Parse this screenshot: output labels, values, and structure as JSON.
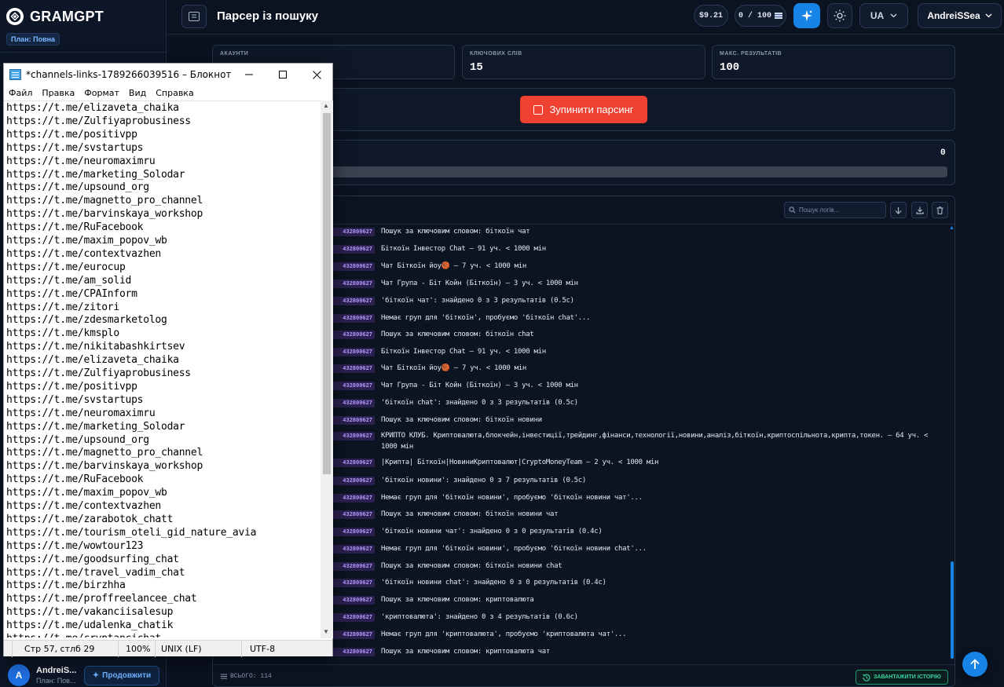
{
  "sidebar": {
    "brand": "GRAMGPT",
    "plan": "План: Повна",
    "user_initial": "A",
    "user_name": "AndreiS...",
    "user_plan": "План: Пов...",
    "upgrade_label": "Продовжити"
  },
  "header": {
    "title": "Парсер із пошуку",
    "balance": "$9.21",
    "usage": "0 / 100",
    "language": "UA",
    "username": "AndreiSSea"
  },
  "stats": [
    {
      "label": "АКАУНТИ",
      "value": ""
    },
    {
      "label": "КЛЮЧОВИХ СЛІВ",
      "value": "15"
    },
    {
      "label": "МАКС. РЕЗУЛЬТАТІВ",
      "value": "100"
    }
  ],
  "controls": {
    "stop_label": "Зупинити парсинг"
  },
  "progress": {
    "count": "0",
    "fraction": 0
  },
  "log": {
    "search_placeholder": "Пошук логів...",
    "tag": "432800627",
    "entries": [
      "Пошук за ключовим словом: біткоїн чат",
      "Біткоїн Інвестор Chat — 91 уч. < 1000 мін",
      "Чат Біткоїн йоу🏀 — 7 уч. < 1000 мін",
      "Чат Група - Біт Койн (Біткоїн) — 3 уч. < 1000 мін",
      "'біткоїн чат': знайдено 0 з 3 результатів (0.5с)",
      "Немає груп для 'біткоїн', пробуємо 'біткоїн chat'...",
      "Пошук за ключовим словом: біткоїн chat",
      "Біткоїн Інвестор Chat — 91 уч. < 1000 мін",
      "Чат Біткоїн йоу🏀 — 7 уч. < 1000 мін",
      "Чат Група - Біт Койн (Біткоїн) — 3 уч. < 1000 мін",
      "'біткоїн chat': знайдено 0 з 3 результатів (0.5с)",
      "Пошук за ключовим словом: біткоїн новини",
      "КРИПТО КЛУБ. Криптовалюта,блокчейн,інвестиції,трейдинг,фінанси,технології,новини,аналіз,біткоїн,криптоспільнота,крипта,токен. — 64 уч. < 1000 мін",
      "|Крипта| Біткоїн|НовиниКриптовалют|CryptoMoneyTeam — 2 уч. < 1000 мін",
      "'біткоїн новини': знайдено 0 з 7 результатів (0.5с)",
      "Немає груп для 'біткоїн новини', пробуємо 'біткоїн новини чат'...",
      "Пошук за ключовим словом: біткоїн новини чат",
      "'біткоїн новини чат': знайдено 0 з 0 результатів (0.4с)",
      "Немає груп для 'біткоїн новини', пробуємо 'біткоїн новини chat'...",
      "Пошук за ключовим словом: біткоїн новини chat",
      "'біткоїн новини chat': знайдено 0 з 0 результатів (0.4с)",
      "Пошук за ключовим словом: криптовалюта",
      "'криптовалюта': знайдено 0 з 4 результатів (0.6с)",
      "Немає груп для 'криптовалюта', пробуємо 'криптовалюта чат'...",
      "Пошук за ключовим словом: криптовалюта чат"
    ],
    "total_label": "ВСЬОГО: 114",
    "history_label": "ЗАВАНТАЖИТИ ІСТОРІЮ"
  },
  "notepad": {
    "title": "*channels-links-1789266039516 – Блокнот",
    "menu": [
      "Файл",
      "Правка",
      "Формат",
      "Вид",
      "Справка"
    ],
    "lines": [
      "https://t.me/elizaveta_chaika",
      "https://t.me/Zulfiyaprobusiness",
      "https://t.me/positivpp",
      "https://t.me/svstartups",
      "https://t.me/neuromaximru",
      "https://t.me/marketing_Solodar",
      "https://t.me/upsound_org",
      "https://t.me/magnetto_pro_channel",
      "https://t.me/barvinskaya_workshop",
      "https://t.me/RuFacebook",
      "https://t.me/maxim_popov_wb",
      "https://t.me/contextvazhen",
      "https://t.me/eurocup",
      "https://t.me/am_solid",
      "https://t.me/CPAInform",
      "https://t.me/zitori",
      "https://t.me/zdesmarketolog",
      "https://t.me/kmsplo",
      "https://t.me/nikitabashkirtsev",
      "https://t.me/elizaveta_chaika",
      "https://t.me/Zulfiyaprobusiness",
      "https://t.me/positivpp",
      "https://t.me/svstartups",
      "https://t.me/neuromaximru",
      "https://t.me/marketing_Solodar",
      "https://t.me/upsound_org",
      "https://t.me/magnetto_pro_channel",
      "https://t.me/barvinskaya_workshop",
      "https://t.me/RuFacebook",
      "https://t.me/maxim_popov_wb",
      "https://t.me/contextvazhen",
      "https://t.me/zarabotok_chatt",
      "https://t.me/tourism_oteli_gid_nature_avia",
      "https://t.me/wowtour123",
      "https://t.me/goodsurfing_chat",
      "https://t.me/travel_vadim_chat",
      "https://t.me/birzhha",
      "https://t.me/proffreelancee_chat",
      "https://t.me/vakanciisalesup",
      "https://t.me/udalenka_chatik",
      "https://t.me/cryptancichat"
    ],
    "status": {
      "position": "Стр 57, стлб 29",
      "zoom": "100%",
      "line_endings": "UNIX (LF)",
      "encoding": "UTF-8"
    }
  },
  "colors": {
    "accent": "#1683e6",
    "danger": "#ee4132",
    "tag_bg": "#2a2150",
    "tag_text": "#b99aff",
    "history": "#39d39a"
  }
}
